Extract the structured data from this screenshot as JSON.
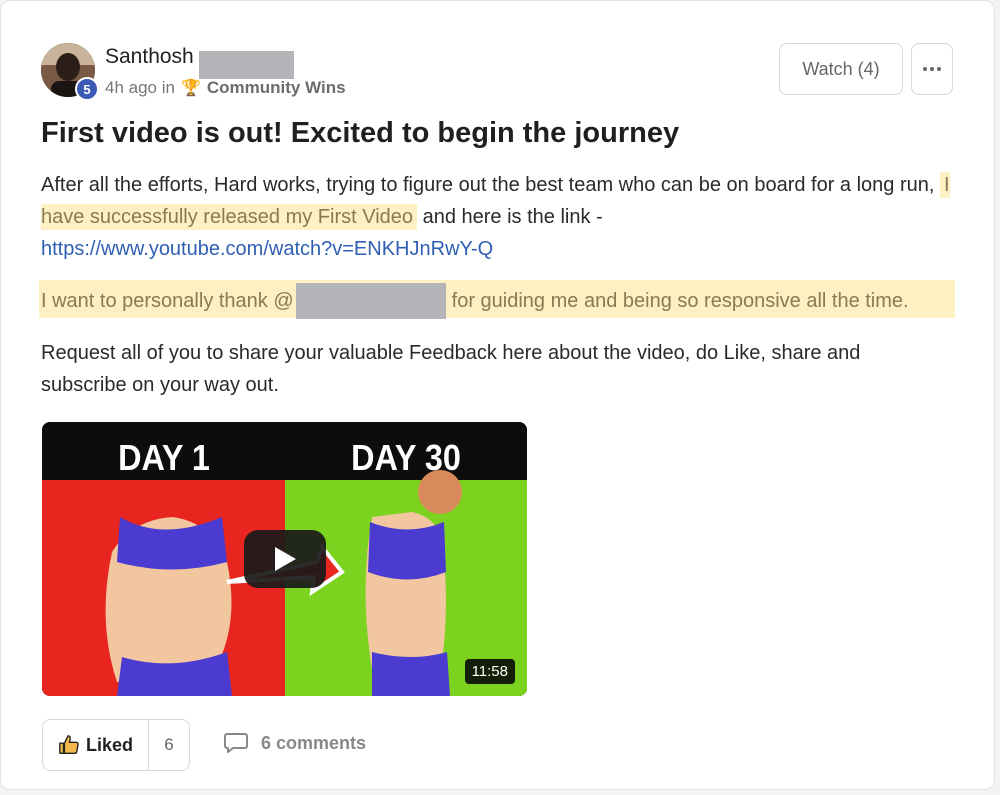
{
  "post": {
    "author": {
      "name": "Santhosh",
      "level": "5"
    },
    "meta": {
      "time": "4h ago in",
      "category_icon": "trophy-icon",
      "category": "Community Wins"
    },
    "watch_label": "Watch (4)",
    "more_icon": "more-dots-icon",
    "title": "First video is out! Excited to begin the journey",
    "body": {
      "p1_start": "After all the efforts, Hard works, trying to figure out the best team who can be on board for a long run,",
      "p1_highlight": "I have successfully released my First Video",
      "p1_end": "and here is the link -",
      "link": "https://www.youtube.com/watch?v=ENKHJnRwY-Q",
      "p2_start": "I want to personally thank @",
      "p2_end": "for guiding me and being so responsive all the time.",
      "p3": "Request all of you to share your valuable Feedback here about the video, do Like, share and subscribe on your way out."
    },
    "video": {
      "left_label": "DAY 1",
      "right_label": "DAY 30",
      "duration": "11:58",
      "colors": {
        "left_bg": "#e8251f",
        "right_bg": "#7bd21f",
        "top_bar": "#0d0d0d"
      }
    },
    "footer": {
      "liked_label": "Liked",
      "like_count": "6",
      "comments_label": "6 comments"
    }
  }
}
